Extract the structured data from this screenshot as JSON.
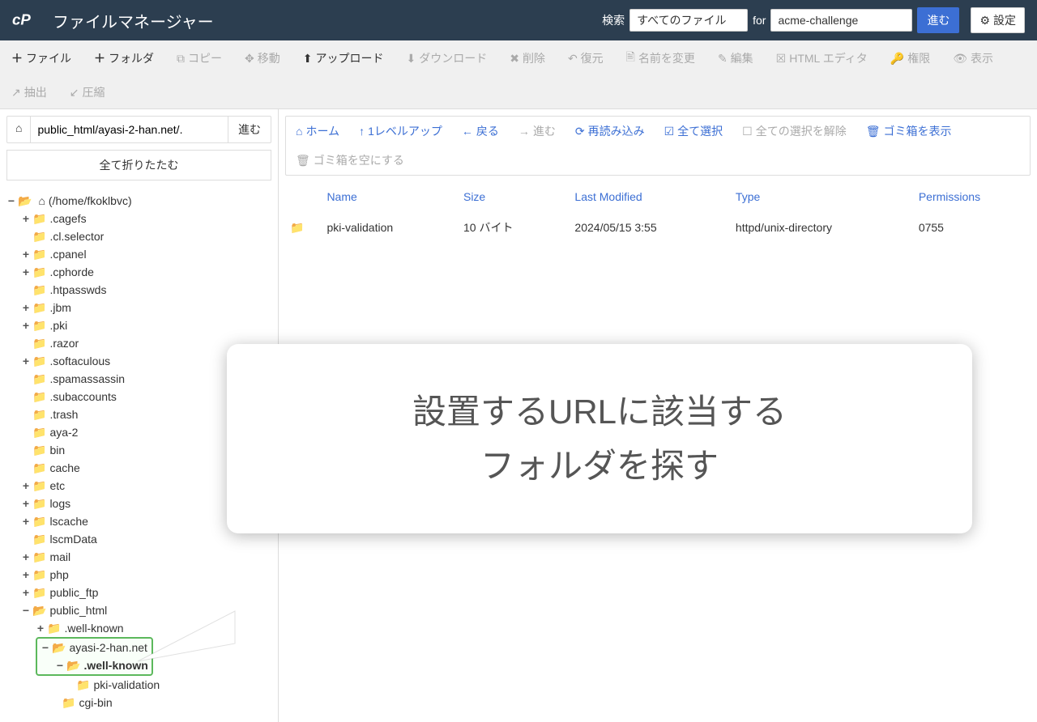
{
  "header": {
    "title": "ファイルマネージャー",
    "search_label": "検索",
    "search_for": "for",
    "search_select": "すべてのファイル",
    "search_value": "acme-challenge",
    "go_button": "進む",
    "settings": "設定"
  },
  "toolbar": {
    "file": "ファイル",
    "folder": "フォルダ",
    "copy": "コピー",
    "move": "移動",
    "upload": "アップロード",
    "download": "ダウンロード",
    "delete": "削除",
    "restore": "復元",
    "rename": "名前を変更",
    "edit": "編集",
    "html_editor": "HTML エディタ",
    "permissions": "権限",
    "view": "表示",
    "extract": "抽出",
    "compress": "圧縮"
  },
  "path": {
    "value": "public_html/ayasi-2-han.net/.",
    "go": "進む"
  },
  "collapse_all": "全て折りたたむ",
  "tree": {
    "root_label": "(/home/fkoklbvc)",
    "folders": [
      {
        "name": ".cagefs",
        "exp": true
      },
      {
        "name": ".cl.selector",
        "exp": false
      },
      {
        "name": ".cpanel",
        "exp": true
      },
      {
        "name": ".cphorde",
        "exp": true
      },
      {
        "name": ".htpasswds",
        "exp": false
      },
      {
        "name": ".jbm",
        "exp": true
      },
      {
        "name": ".pki",
        "exp": true
      },
      {
        "name": ".razor",
        "exp": false
      },
      {
        "name": ".softaculous",
        "exp": true
      },
      {
        "name": ".spamassassin",
        "exp": false
      },
      {
        "name": ".subaccounts",
        "exp": false
      },
      {
        "name": ".trash",
        "exp": false
      },
      {
        "name": "aya-2",
        "exp": false
      },
      {
        "name": "bin",
        "exp": false
      },
      {
        "name": "cache",
        "exp": false
      },
      {
        "name": "etc",
        "exp": true
      },
      {
        "name": "logs",
        "exp": true
      },
      {
        "name": "lscache",
        "exp": true
      },
      {
        "name": "lscmData",
        "exp": false
      },
      {
        "name": "mail",
        "exp": true
      },
      {
        "name": "php",
        "exp": true
      },
      {
        "name": "public_ftp",
        "exp": true
      }
    ],
    "public_html": "public_html",
    "well_known_1": ".well-known",
    "ayasi": "ayasi-2-han.net",
    "well_known_2": ".well-known",
    "pki_validation": "pki-validation",
    "cgi_bin": "cgi-bin"
  },
  "actions": {
    "home": "ホーム",
    "up": "1レベルアップ",
    "back": "戻る",
    "forward": "進む",
    "reload": "再読み込み",
    "select_all": "全て選択",
    "unselect_all": "全ての選択を解除",
    "view_trash": "ゴミ箱を表示",
    "empty_trash": "ゴミ箱を空にする"
  },
  "table": {
    "headers": {
      "name": "Name",
      "size": "Size",
      "last_modified": "Last Modified",
      "type": "Type",
      "permissions": "Permissions"
    },
    "rows": [
      {
        "name": "pki-validation",
        "size": "10 バイト",
        "last_modified": "2024/05/15 3:55",
        "type": "httpd/unix-directory",
        "permissions": "0755"
      }
    ]
  },
  "callout": {
    "line1": "設置するURLに該当する",
    "line2": "フォルダを探す"
  }
}
